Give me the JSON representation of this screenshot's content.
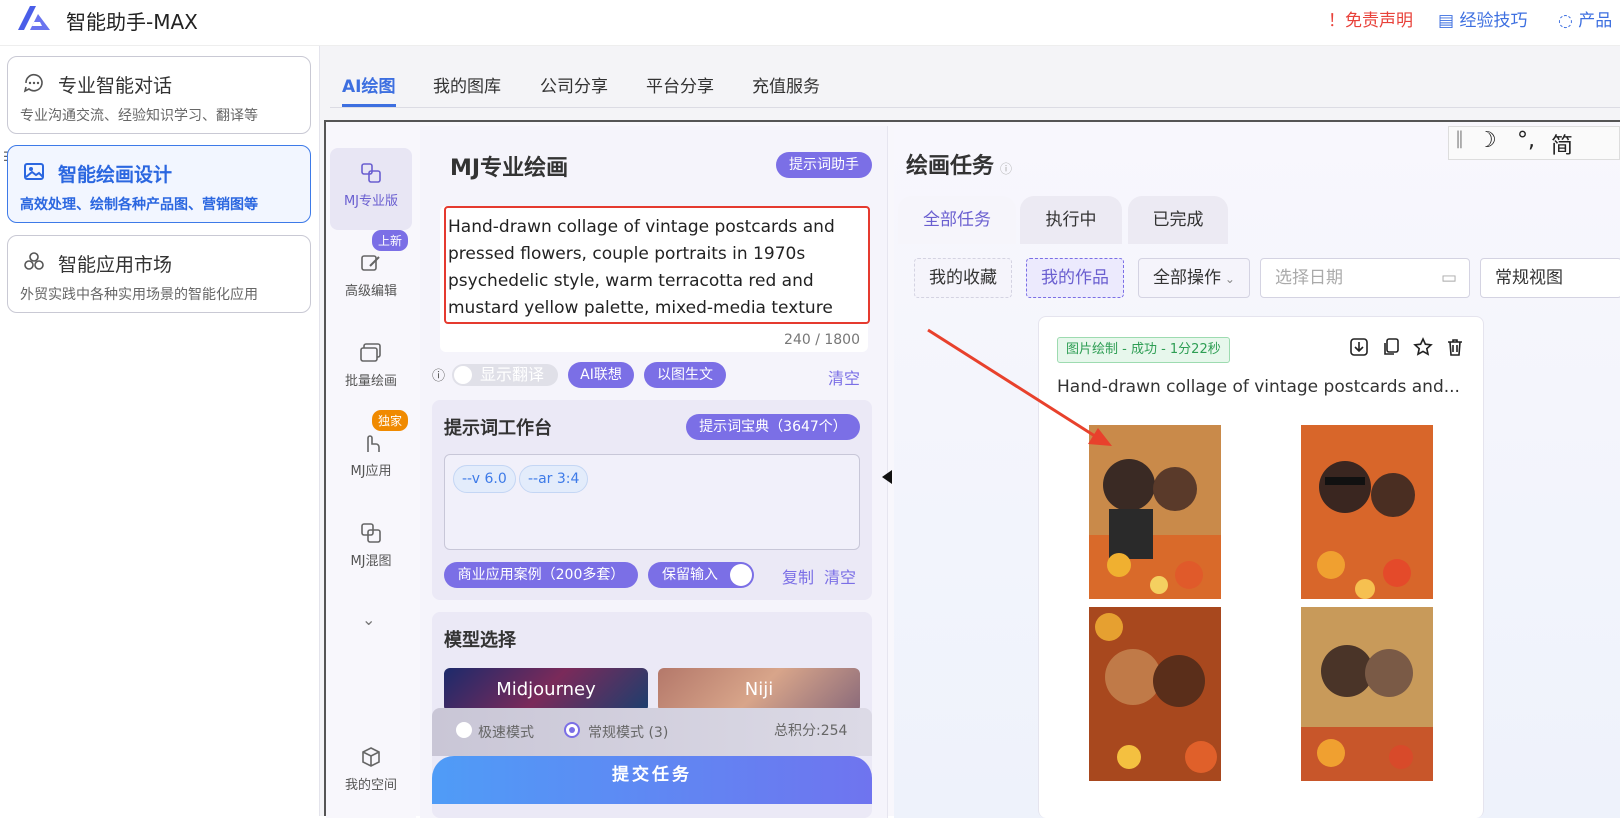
{
  "app": {
    "title": "智能助手-MAX",
    "brand_color": "#4a5ee8"
  },
  "top_links": {
    "disclaimer": "！免责声明",
    "tips": "经验技巧",
    "product": "产品"
  },
  "sidebar": {
    "items": [
      {
        "title": "专业智能对话",
        "desc": "专业沟通交流、经验知识学习、翻译等",
        "icon": "chat-bubble-icon"
      },
      {
        "title": "智能绘画设计",
        "desc": "高效处理、绘制各种产品图、营销图等",
        "icon": "image-icon",
        "active": true
      },
      {
        "title": "智能应用市场",
        "desc": "外贸实践中各种实用场景的智能化应用",
        "icon": "apps-icon"
      }
    ]
  },
  "tabs": [
    "AI绘图",
    "我的图库",
    "公司分享",
    "平台分享",
    "充值服务"
  ],
  "ime": {
    "sep": "‖",
    "moon": "☽",
    "punct": "°,",
    "lang": "简"
  },
  "rail": {
    "items": [
      {
        "label": "MJ专业版",
        "icon": "mj-pro-icon",
        "active": true
      },
      {
        "label": "高级编辑",
        "icon": "edit-icon",
        "badge": "上新"
      },
      {
        "label": "批量绘画",
        "icon": "batch-icon"
      },
      {
        "label": "MJ应用",
        "icon": "hand-pointer-icon",
        "badge": "独家"
      },
      {
        "label": "MJ混图",
        "icon": "blend-icon"
      },
      {
        "label": "我的空间",
        "icon": "cube-icon"
      }
    ]
  },
  "form": {
    "title": "MJ专业绘画",
    "helper_btn": "提示词助手",
    "prompt": "Hand-drawn collage of vintage postcards and pressed flowers, couple portraits in 1970s psychedelic style, warm terracotta red and mustard yellow palette, mixed-media texture with",
    "counter": "240 / 1800",
    "translate_label": "显示翻译",
    "ai_assoc": "AI联想",
    "img2text": "以图生文",
    "clear": "清空",
    "workbench": {
      "title": "提示词工作台",
      "dict_btn": "提示词宝典（3647个）",
      "chips": [
        "--v 6.0",
        "--ar 3:4"
      ],
      "cases_btn": "商业应用案例（200多套）",
      "keep_input": "保留输入",
      "copy": "复制",
      "clear": "清空"
    },
    "model": {
      "title": "模型选择",
      "models": [
        "Midjourney",
        "Niji"
      ],
      "mode_fast": "极速模式",
      "mode_normal": "常规模式 (3)",
      "points": "总积分:254",
      "submit": "提交任务"
    }
  },
  "tasks": {
    "title": "绘画任务",
    "sub_tabs": [
      "全部任务",
      "执行中",
      "已完成"
    ],
    "filters": {
      "favorites": "我的收藏",
      "my_works": "我的作品",
      "all_ops": "全部操作",
      "date_placeholder": "选择日期",
      "view": "常规视图"
    },
    "card": {
      "status": "图片绘制 - 成功 - 1分22秒",
      "desc": "Hand-drawn collage of vintage postcards and...",
      "actions": [
        "download-icon",
        "copy-icon",
        "star-icon",
        "trash-icon"
      ]
    }
  },
  "colors": {
    "accent": "#7b6fe6",
    "link": "#3d6fe0",
    "error": "#e53a2f",
    "success": "#2e9e54"
  }
}
